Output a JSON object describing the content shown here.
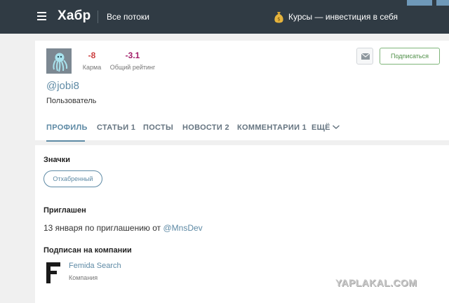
{
  "header": {
    "logo": "Хабр",
    "all_flows": "Все потоки",
    "promo_text": "Курсы — инвестиция в себя"
  },
  "profile": {
    "karma_value": "-8",
    "karma_label": "Карма",
    "rating_value": "-3.1",
    "rating_label": "Общий рейтинг",
    "subscribe_label": "Подписаться",
    "username": "@jobi8",
    "role": "Пользователь"
  },
  "tabs": [
    {
      "label": "ПРОФИЛЬ"
    },
    {
      "label": "СТАТЬИ 1"
    },
    {
      "label": "ПОСТЫ"
    },
    {
      "label": "НОВОСТИ 2"
    },
    {
      "label": "КОММЕНТАРИИ 1"
    },
    {
      "label": "ЕЩЁ"
    }
  ],
  "badges": {
    "title": "Значки",
    "items": [
      "Отхабренный"
    ]
  },
  "invited": {
    "title": "Приглашен",
    "text": "13 января по приглашению от ",
    "inviter": "@MnsDev"
  },
  "companies": {
    "title": "Подписан на компании",
    "items": [
      {
        "name": "Femida Search",
        "type": "Компания"
      }
    ]
  },
  "watermark": "YAPLAKAL.COM",
  "colors": {
    "header_bg": "#303b44",
    "link": "#5e8aa5",
    "karma": "#cc3d3d",
    "rating": "#a31e69",
    "subscribe": "#4f8f48"
  }
}
